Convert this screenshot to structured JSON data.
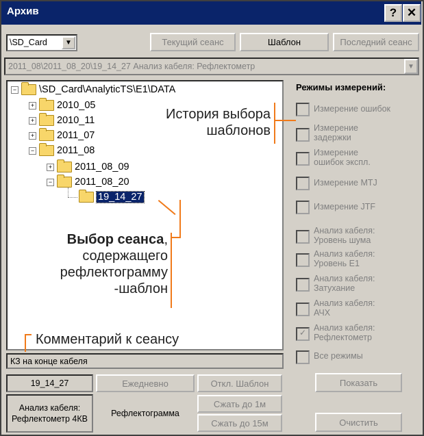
{
  "window": {
    "title": "Архив",
    "help_label": "?",
    "close_label": "✕"
  },
  "toolbar": {
    "drive_value": "\\SD_Card",
    "current_session": "Текущий сеанс",
    "template": "Шаблон",
    "last_session": "Последний сеанс"
  },
  "path_field": {
    "value": "2011_08\\2011_08_20\\19_14_27 Анализ кабеля: Рефлектометр"
  },
  "tree": {
    "root": "\\SD_Card\\AnalyticTS\\E1\\DATA",
    "items": [
      "2010_05",
      "2010_11",
      "2011_07",
      "2011_08",
      "2011_08_09",
      "2011_08_20",
      "19_14_27"
    ]
  },
  "modes": {
    "header": "Режимы измерений:",
    "items": [
      {
        "label": "Измерение ошибок",
        "checked": false
      },
      {
        "label": "Измерение задержки",
        "checked": false
      },
      {
        "label": "Измерение ошибок экспл.",
        "checked": false
      },
      {
        "label": "Измерение MTJ",
        "checked": false
      },
      {
        "label": "Измерение JTF",
        "checked": false
      },
      {
        "label": "Анализ кабеля: Уровень шума",
        "checked": false
      },
      {
        "label": "Анализ кабеля: Уровень E1",
        "checked": false
      },
      {
        "label": "Анализ кабеля: Затухание",
        "checked": false
      },
      {
        "label": "Анализ кабеля: АЧХ",
        "checked": false
      },
      {
        "label": "Анализ кабеля: Рефлектометр",
        "checked": true
      },
      {
        "label": "Все режимы",
        "checked": false
      }
    ],
    "check_mark": "✓"
  },
  "comment": {
    "value": "КЗ на конце кабеля"
  },
  "bottom": {
    "session_name": "19_14_27",
    "daily": "Ежедневно",
    "disable_template": "Откл. Шаблон",
    "show": "Показать",
    "mode_info": "Анализ кабеля: Рефлектометр 4КВ",
    "type_info": "Рефлектограмма",
    "compress_1m": "Сжать до 1м",
    "compress_15m": "Сжать до 15м",
    "clear": "Очистить"
  },
  "annotations": {
    "history_line1": "История выбора",
    "history_line2": "шаблонов",
    "select_bold": "Выбор сеанса",
    "select_comma": ",",
    "select_line2": "содержащего",
    "select_line3": "рефлектограмму",
    "select_line4": "-шаблон",
    "comment_label": "Комментарий к сеансу"
  },
  "colors": {
    "accent": "#0a246a",
    "annotation_line": "#f07a1a"
  }
}
